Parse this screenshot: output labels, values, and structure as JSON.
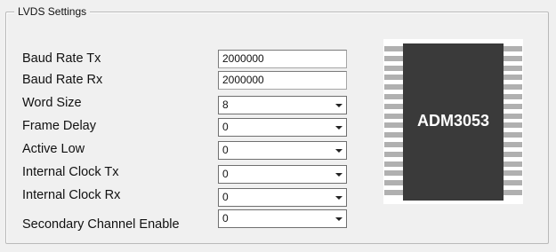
{
  "group": {
    "title": "LVDS Settings"
  },
  "fields": [
    {
      "label": "Baud Rate Tx",
      "type": "text",
      "value": "2000000"
    },
    {
      "label": "Baud Rate Rx",
      "type": "text",
      "value": "2000000"
    },
    {
      "label": "Word Size",
      "type": "select",
      "value": "8"
    },
    {
      "label": "Frame Delay",
      "type": "select",
      "value": "0"
    },
    {
      "label": "Active Low",
      "type": "select",
      "value": "0"
    },
    {
      "label": "Internal Clock Tx",
      "type": "select",
      "value": "0"
    },
    {
      "label": "Internal Clock Rx",
      "type": "select",
      "value": "0"
    },
    {
      "label": "Secondary Channel Enable",
      "type": "select",
      "value": "0"
    }
  ],
  "chip": {
    "label": "ADM3053",
    "icon": "ic-chip-icon"
  }
}
